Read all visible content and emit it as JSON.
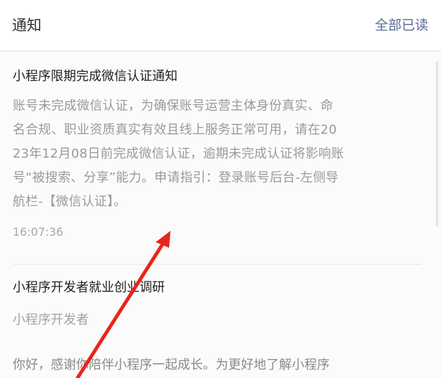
{
  "header": {
    "title": "通知",
    "mark_all_read": "全部已读"
  },
  "notifications": [
    {
      "title": "小程序限期完成微信认证通知",
      "lines": [
        "账号未完成微信认证，为确保账号运营主体身份真实、命",
        "名合规、职业资质真实有效且线上服务正常可用，请在20",
        "23年12月08日前完成微信认证，逾期未完成认证将影响账",
        "号“被搜索、分享”能力。申请指引：登录账号后台-左侧导",
        "航栏-【微信认证】。"
      ],
      "time": "16:07:36"
    },
    {
      "title": "小程序开发者就业创业调研",
      "sender": "小程序开发者",
      "body_preview": "你好，感谢你陪伴小程序一起成长。为更好地了解小程序"
    }
  ],
  "annotation": {
    "arrow_color": "#e8251c"
  }
}
